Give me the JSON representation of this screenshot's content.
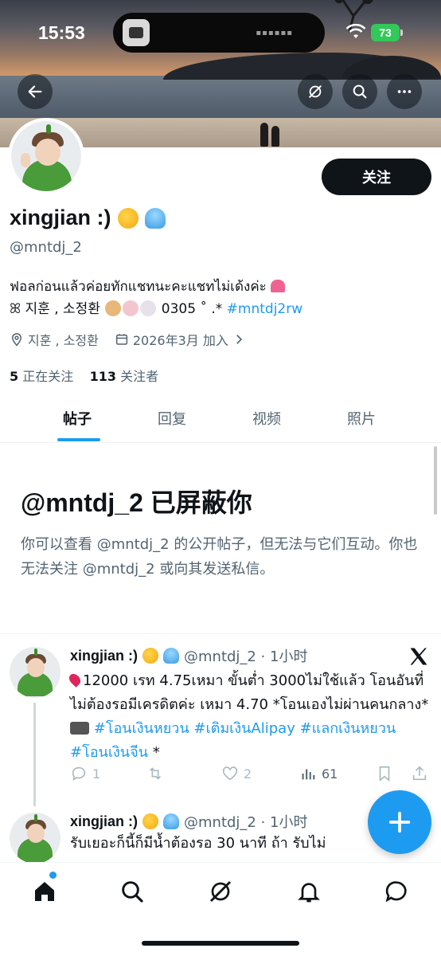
{
  "status_bar": {
    "time": "15:53",
    "battery": "73"
  },
  "profile": {
    "display_name": "xingjian :)",
    "handle": "@mntdj_2",
    "follow_label": "关注",
    "bio_line1": "ฟอลก่อนแล้วค่อยทักแชทนะคะแชทไม่เด้งค่ะ",
    "bio_line2_prefix": "ꕤ 지훈 , 소정환",
    "bio_line2_code": "0305 ˚ .*",
    "bio_hashtag": "#mntdj2rw",
    "location": "지훈 , 소정환",
    "joined": "2026年3月 加入",
    "following_count": "5",
    "following_label": "正在关注",
    "followers_count": "113",
    "followers_label": "关注者"
  },
  "tabs": [
    {
      "label": "帖子",
      "active": true
    },
    {
      "label": "回复",
      "active": false
    },
    {
      "label": "视频",
      "active": false
    },
    {
      "label": "照片",
      "active": false
    }
  ],
  "blocked": {
    "title": "@mntdj_2 已屏蔽你",
    "description": "你可以查看 @mntdj_2 的公开帖子，但无法与它们互动。你也无法关注 @mntdj_2 或向其发送私信。"
  },
  "posts": [
    {
      "name": "xingjian :)",
      "handle_time": "@mntdj_2 · 1小时",
      "text_a": "12000 เรท 4.75เหมา ขั้นต่ำ 3000ไม่ใช้แล้ว โอนอันที่ไม่ต้องรอมีเครดิตค่ะ เหมา 4.70 *โอนเองไม่ผ่านคนกลาง*",
      "hashtags": "#โอนเงินหยวน #เติมเงินAlipay #แลกเงินหยวน #โอนเงินจีน",
      "text_tail": "*",
      "replies": "1",
      "likes": "2",
      "views": "61"
    },
    {
      "name": "xingjian :)",
      "handle_time": "@mntdj_2 · 1小时",
      "text_a": "รับเยอะก็นี้ก็มีน้ำต้องรอ 30 นาที ถ้า รับไม่"
    }
  ],
  "colors": {
    "accent": "#1d9bf0",
    "text": "#0f1419",
    "muted": "#536471"
  }
}
